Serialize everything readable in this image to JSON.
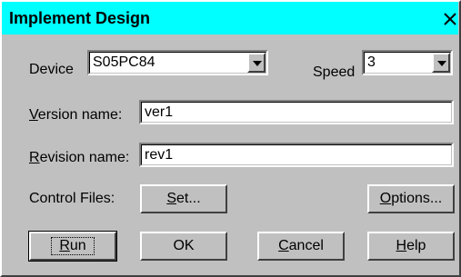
{
  "dialog": {
    "title": "Implement Design",
    "close_symbol": "✕"
  },
  "device": {
    "label": "Device",
    "value": "S05PC84"
  },
  "speed": {
    "label": "Speed",
    "value": "3"
  },
  "version_name": {
    "label_hot": "V",
    "label_rest": "ersion name:",
    "value": "ver1"
  },
  "revision_name": {
    "label_hot": "R",
    "label_rest": "evision name:",
    "value": "rev1"
  },
  "control_files": {
    "label": "Control Files:",
    "set_hot": "S",
    "set_rest": "et...",
    "options_hot": "O",
    "options_rest": "ptions..."
  },
  "buttons": {
    "run_hot": "R",
    "run_rest": "un",
    "ok": "OK",
    "cancel_hot": "C",
    "cancel_rest": "ancel",
    "help_hot": "H",
    "help_rest": "elp"
  },
  "colors": {
    "titlebar": "#00ffff",
    "face": "#c0c0c0"
  },
  "icons": {
    "close": "close-icon",
    "dropdown": "chevron-down-icon"
  }
}
